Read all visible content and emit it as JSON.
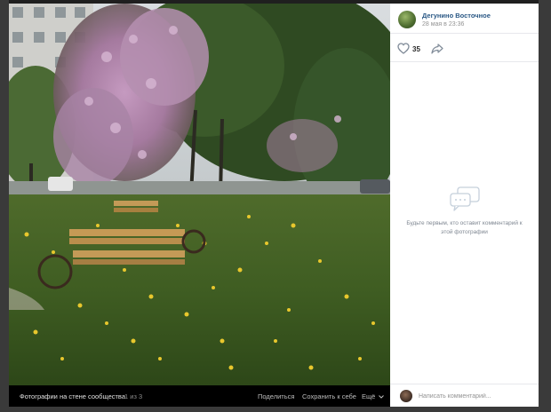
{
  "post": {
    "author": "Дегунино Восточное",
    "date": "28 мая в 23:36",
    "likes": "35"
  },
  "comments": {
    "empty_text": "Будьте первым, кто оставит комментарий к этой фотографии",
    "placeholder": "Написать комментарий..."
  },
  "photo_bar": {
    "album": "Фотографии на стене сообщества",
    "counter": "1 из 3",
    "share": "Поделиться",
    "save": "Сохранить к себе",
    "more": "Ещё"
  },
  "icons": {
    "like": "heart-icon",
    "share": "share-arrow-icon",
    "comments": "speech-bubbles-icon",
    "more": "chevron-down-icon"
  },
  "colors": {
    "accent": "#2a5885",
    "muted": "#939393",
    "background": "#1f1f1f"
  }
}
